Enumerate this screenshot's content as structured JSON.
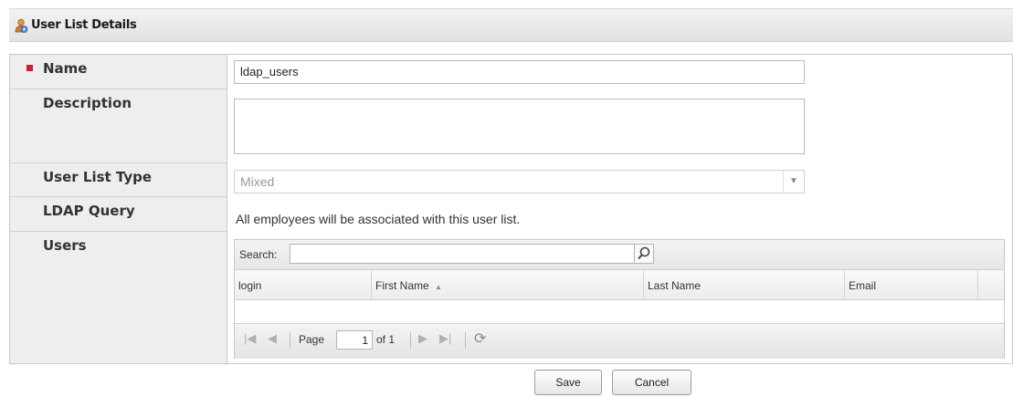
{
  "header": {
    "title": "User List Details",
    "icon": "user-group-icon"
  },
  "fields": {
    "name": {
      "label": "Name",
      "value": "ldap_users",
      "required": true
    },
    "description": {
      "label": "Description",
      "value": ""
    },
    "user_list_type": {
      "label": "User List Type",
      "value": "Mixed"
    },
    "ldap_query": {
      "label": "LDAP Query",
      "value": "All employees will be associated with this user list."
    },
    "users": {
      "label": "Users"
    }
  },
  "grid": {
    "search_label": "Search:",
    "search_value": "",
    "columns": [
      "login",
      "First Name",
      "Last Name",
      "Email"
    ],
    "sort_indicator": "▲",
    "rows": [],
    "pagination": {
      "page_label": "Page",
      "page_value": "1",
      "of_label": "of 1"
    }
  },
  "buttons": {
    "save": "Save",
    "cancel": "Cancel"
  },
  "colors": {
    "required": "#cc1f36",
    "header_bg": "#e8e8e8",
    "label_bg": "#eeeeee"
  }
}
